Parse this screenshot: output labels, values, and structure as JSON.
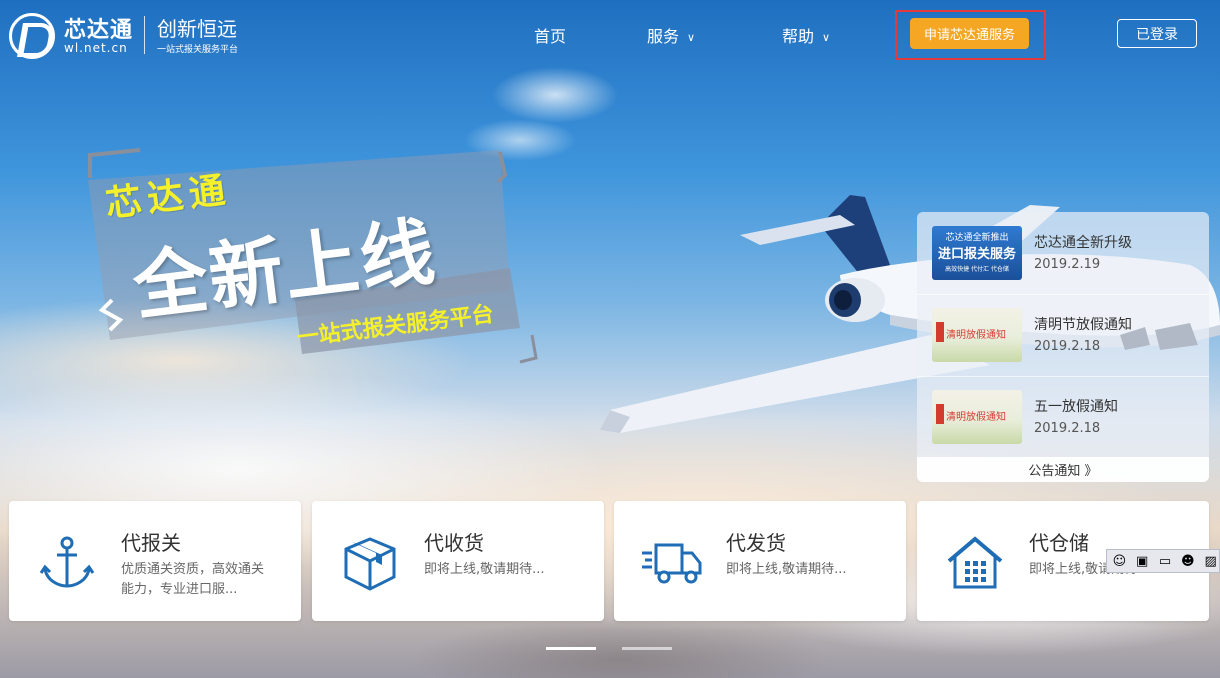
{
  "brand": {
    "name": "芯达通",
    "url": "wl.net.cn",
    "slogan": "创新恒远",
    "sub": "一站式报关服务平台"
  },
  "nav": {
    "home": "首页",
    "services": "服务",
    "help": "帮助",
    "apply": "申请芯达通服务",
    "login": "已登录"
  },
  "hero": {
    "brand": "芯达通",
    "title": "全新上线",
    "sub": "一站式报关服务平台"
  },
  "notices": {
    "items": [
      {
        "thumb_line1": "芯达通全新推出",
        "thumb_line2": "进口报关服务",
        "thumb_line3": "高效快捷  代付汇  代仓储",
        "title": "芯达通全新升级",
        "date": "2019.2.19"
      },
      {
        "thumb_text": "清明放假通知",
        "title": "清明节放假通知",
        "date": "2019.2.18"
      },
      {
        "thumb_text": "清明放假通知",
        "title": "五一放假通知",
        "date": "2019.2.18"
      }
    ],
    "more": "公告通知 》"
  },
  "services": [
    {
      "title": "代报关",
      "desc": "优质通关资质，高效通关能力，专业进口服...",
      "icon": "anchor-icon"
    },
    {
      "title": "代收货",
      "desc": "即将上线,敬请期待...",
      "icon": "box-icon"
    },
    {
      "title": "代发货",
      "desc": "即将上线,敬请期待...",
      "icon": "truck-icon"
    },
    {
      "title": "代仓储",
      "desc": "即将上线,敬请期待...",
      "icon": "warehouse-icon"
    }
  ],
  "colors": {
    "accent": "#f5a623",
    "icon_blue": "#1f6db5",
    "highlight": "#e23b3b"
  }
}
